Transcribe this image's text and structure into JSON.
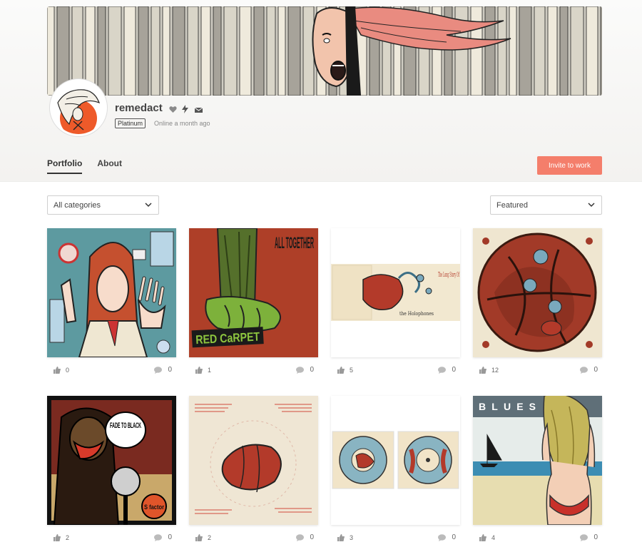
{
  "profile": {
    "username": "remedact",
    "badge": "Platinum",
    "status": "Online a month ago",
    "icons": [
      "heart-icon",
      "lightning-icon",
      "mail-icon"
    ]
  },
  "tabs": [
    {
      "label": "Portfolio",
      "active": true
    },
    {
      "label": "About",
      "active": false
    }
  ],
  "invite_button": "Invite to work",
  "filters": {
    "category": "All categories",
    "sort": "Featured"
  },
  "items": [
    {
      "likes": "0",
      "comments": "0"
    },
    {
      "likes": "1",
      "comments": "0"
    },
    {
      "likes": "5",
      "comments": "0"
    },
    {
      "likes": "12",
      "comments": "0"
    },
    {
      "likes": "2",
      "comments": "0"
    },
    {
      "likes": "2",
      "comments": "0"
    },
    {
      "likes": "3",
      "comments": "0"
    },
    {
      "likes": "4",
      "comments": "0"
    }
  ],
  "artwork_text": {
    "all_together": "ALL TOGETHER",
    "red_carpet": "RED CaRPET",
    "long_story": "The Long Story Of",
    "the_holophones": "the Holophones",
    "fade_to_black": "FADE TO BLACK",
    "s_factor": "S factor",
    "blues": "BLUES"
  },
  "colors": {
    "accent": "#f47e6b",
    "text": "#333333"
  }
}
